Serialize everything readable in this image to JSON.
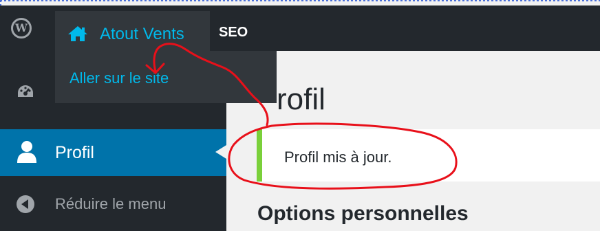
{
  "admin_bar": {
    "site_name": "Atout Vents",
    "seo_label": "SEO",
    "wp_logo_icon": "wordpress-icon",
    "home_icon": "home-icon"
  },
  "dropdown": {
    "visit_site_label": "Aller sur le site"
  },
  "sidebar": {
    "dashboard_icon": "dashboard-icon",
    "items": [
      {
        "label": "Profil",
        "icon": "user-icon",
        "active": true
      },
      {
        "label": "Réduire le menu",
        "icon": "collapse-icon"
      }
    ]
  },
  "main": {
    "title": "rofil",
    "notice": "Profil mis à jour.",
    "section_title": "Options personnelles"
  },
  "colors": {
    "admin_bar": "#23282d",
    "active_menu": "#0073aa",
    "link": "#00b9eb",
    "notice_border": "#7ad03a",
    "annotation": "#e8101a"
  }
}
